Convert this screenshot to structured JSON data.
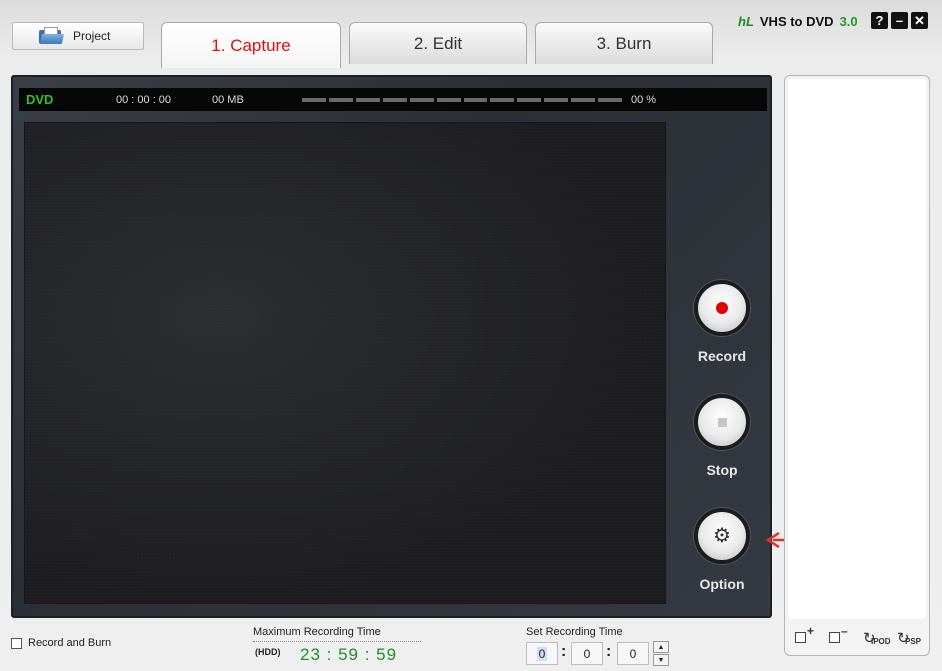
{
  "toolbar": {
    "project_label": "Project"
  },
  "tabs": [
    {
      "label": "1. Capture",
      "active": true
    },
    {
      "label": "2. Edit",
      "active": false
    },
    {
      "label": "3. Burn",
      "active": false
    }
  ],
  "brand": {
    "name": "VHS to DVD",
    "version": "3.0"
  },
  "window_buttons": {
    "help": "?",
    "minimize": "–",
    "close": "✕"
  },
  "status": {
    "format": "DVD",
    "elapsed": "00 : 00 : 00",
    "size": "00 MB",
    "percent": "00 %"
  },
  "controls": {
    "record_label": "Record",
    "stop_label": "Stop",
    "option_label": "Option"
  },
  "right_tools": {
    "ipod_label": "IPOD",
    "psp_label": "PSP"
  },
  "bottom": {
    "record_and_burn_label": "Record and Burn",
    "max_recording_label": "Maximum Recording Time",
    "hdd_label": "(HDD)",
    "max_recording_time": "23 : 59 : 59",
    "set_recording_label": "Set Recording Time",
    "set_hours": "0",
    "set_minutes": "0",
    "set_seconds": "0"
  },
  "colors": {
    "accent_red": "#e01010",
    "green": "#1f8f1f",
    "panel_dark": "#2a2e35"
  }
}
